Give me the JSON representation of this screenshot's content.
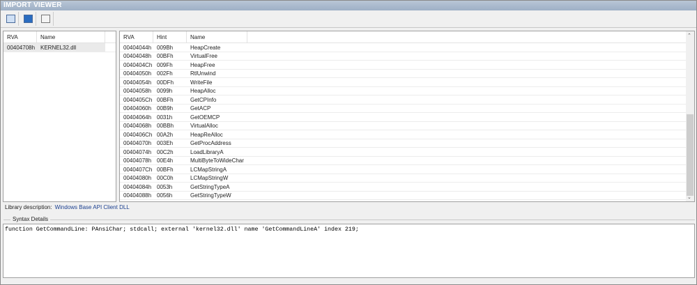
{
  "title": "IMPORT VIEWER",
  "toolbar": {
    "icons": [
      "save-icon",
      "edit-icon",
      "export-icon"
    ]
  },
  "libraries": {
    "columns": [
      "RVA",
      "Name"
    ],
    "rows": [
      [
        "00404708h",
        "KERNEL32.dll"
      ]
    ]
  },
  "functions": {
    "columns": [
      "RVA",
      "Hint",
      "Name"
    ],
    "rows": [
      [
        "00404044h",
        "009Bh",
        "HeapCreate"
      ],
      [
        "00404048h",
        "00BFh",
        "VirtualFree"
      ],
      [
        "0040404Ch",
        "009Fh",
        "HeapFree"
      ],
      [
        "00404050h",
        "002Fh",
        "RtlUnwind"
      ],
      [
        "00404054h",
        "00DFh",
        "WriteFile"
      ],
      [
        "00404058h",
        "0099h",
        "HeapAlloc"
      ],
      [
        "0040405Ch",
        "00BFh",
        "GetCPInfo"
      ],
      [
        "00404060h",
        "00B9h",
        "GetACP"
      ],
      [
        "00404064h",
        "0031h",
        "GetOEMCP"
      ],
      [
        "00404068h",
        "00BBh",
        "VirtualAlloc"
      ],
      [
        "0040406Ch",
        "00A2h",
        "HeapReAlloc"
      ],
      [
        "00404070h",
        "003Eh",
        "GetProcAddress"
      ],
      [
        "00404074h",
        "00C2h",
        "LoadLibraryA"
      ],
      [
        "00404078h",
        "00E4h",
        "MultiByteToWideChar"
      ],
      [
        "0040407Ch",
        "00BFh",
        "LCMapStringA"
      ],
      [
        "00404080h",
        "00C0h",
        "LCMapStringW"
      ],
      [
        "00404084h",
        "0053h",
        "GetStringTypeA"
      ],
      [
        "00404088h",
        "0056h",
        "GetStringTypeW"
      ]
    ]
  },
  "library_description": {
    "label": "Library description:",
    "value": "Windows Base API Client DLL"
  },
  "syntax": {
    "group_label": "Syntax Details",
    "text": "function GetCommandLine: PAnsiChar; stdcall; external 'kernel32.dll' name 'GetCommandLineA' index 219;"
  }
}
